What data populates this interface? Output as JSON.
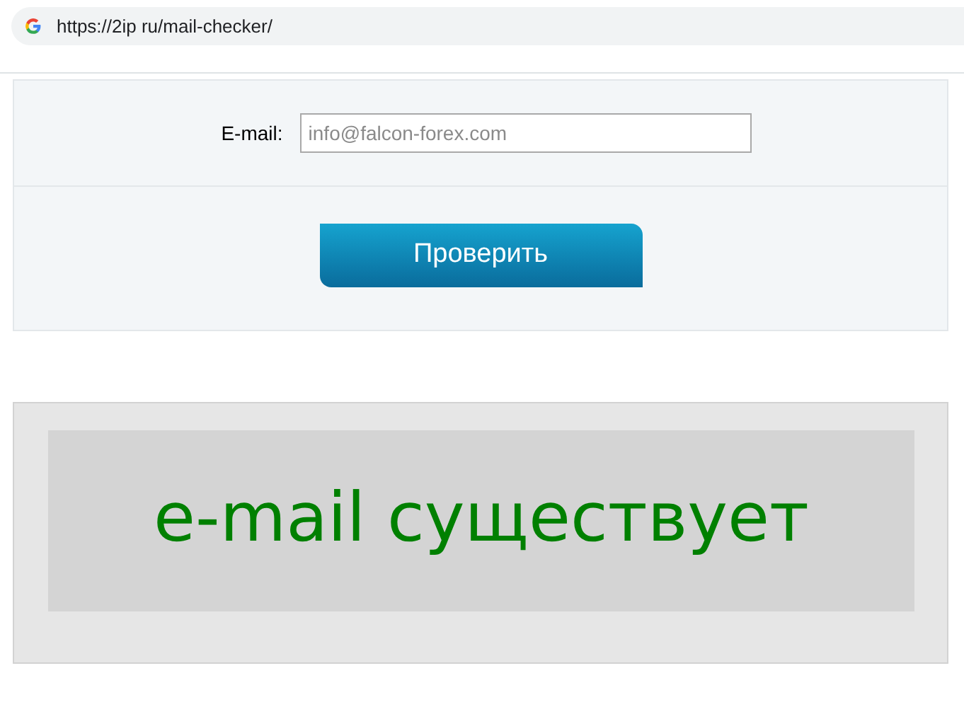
{
  "address_bar": {
    "url": "https://2ip ru/mail-checker/"
  },
  "form": {
    "email_label": "E-mail:",
    "email_field": {
      "placeholder": "info@falcon-forex.com"
    },
    "submit_button": "Проверить"
  },
  "result": {
    "message": "e-mail существует",
    "color": "#008000"
  }
}
